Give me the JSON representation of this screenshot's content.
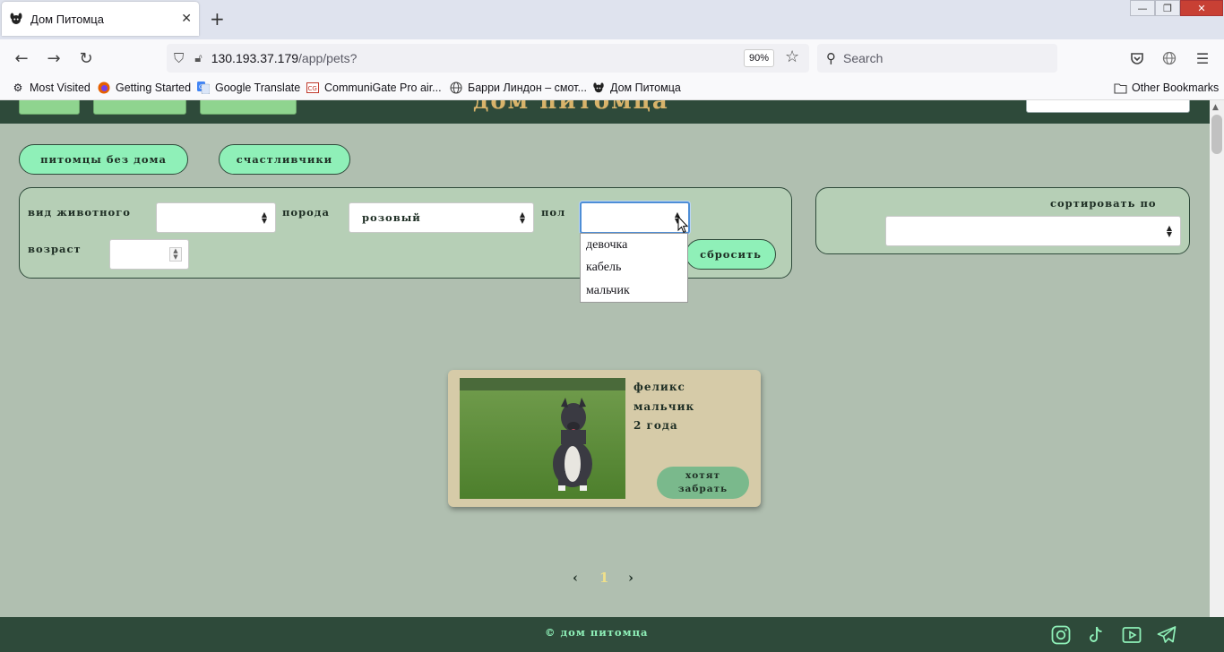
{
  "browser": {
    "tab_title": "Дом Питомца",
    "tab_close": "✕",
    "new_tab": "+",
    "url_host": "130.193.37.179",
    "url_path": "/app/pets?",
    "zoom": "90%",
    "search_placeholder": "Search",
    "bookmarks": [
      "Most Visited",
      "Getting Started",
      "Google Translate",
      "CommuniGate Pro air...",
      "Барри Линдон – смот...",
      "Дом Питомца"
    ],
    "other_bookmarks": "Other Bookmarks"
  },
  "header": {
    "site_title": "дом питомца"
  },
  "tabs": {
    "homeless": "питомцы без дома",
    "lucky": "счастливчики"
  },
  "filters": {
    "species_label": "вид животного",
    "species_value": "",
    "breed_label": "порода",
    "breed_value": "розовый",
    "gender_label": "пол",
    "gender_value": "",
    "gender_options": [
      "девочка",
      "кабель",
      "мальчик"
    ],
    "age_label": "возраст",
    "age_value": "",
    "reset": "сбросить"
  },
  "sort": {
    "label": "сортировать по",
    "value": ""
  },
  "pets": [
    {
      "name": "феликс",
      "gender": "мальчик",
      "age": "2 года",
      "action_line1": "хотят",
      "action_line2": "забрать"
    }
  ],
  "pagination": {
    "prev": "‹",
    "current": "1",
    "next": "›"
  },
  "footer": {
    "copyright": "© дом питомца"
  },
  "colors": {
    "page_bg": "#b0bfb0",
    "dark_green": "#2e4a3a",
    "pill_green": "#8ff0b8",
    "card_bg": "#d6cba8",
    "title_gold": "#d8b36a"
  }
}
